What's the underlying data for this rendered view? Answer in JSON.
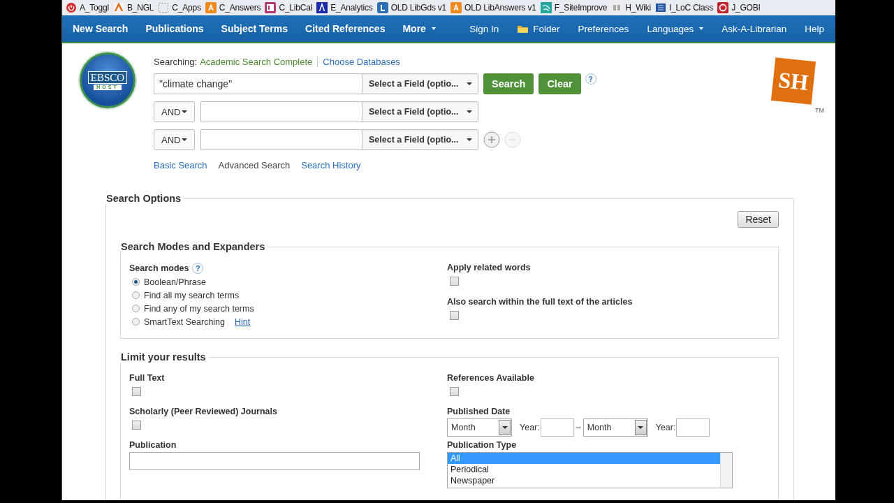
{
  "bookmarks": [
    {
      "label": "A_Toggl"
    },
    {
      "label": "B_NGL"
    },
    {
      "label": "C_Apps"
    },
    {
      "label": "C_Answers"
    },
    {
      "label": "C_LibCal"
    },
    {
      "label": "E_Analytics"
    },
    {
      "label": "OLD LibGds v1"
    },
    {
      "label": "OLD LibAnswers v1"
    },
    {
      "label": "F_SiteImprove"
    },
    {
      "label": "H_Wiki"
    },
    {
      "label": "I_LoC Class"
    },
    {
      "label": "J_GOBI"
    }
  ],
  "nav": {
    "left": [
      {
        "label": "New Search",
        "kind": "link",
        "dropdown": false
      },
      {
        "label": "Publications",
        "kind": "link",
        "dropdown": false
      },
      {
        "label": "Subject Terms",
        "kind": "link",
        "dropdown": false
      },
      {
        "label": "Cited References",
        "kind": "link",
        "dropdown": false
      },
      {
        "label": "More",
        "kind": "link",
        "dropdown": true
      }
    ],
    "right": [
      {
        "label": "Sign In",
        "kind": "link",
        "dropdown": false
      },
      {
        "label": "Folder",
        "kind": "folder",
        "dropdown": false
      },
      {
        "label": "Preferences",
        "kind": "link",
        "dropdown": false
      },
      {
        "label": "Languages",
        "kind": "link",
        "dropdown": true
      },
      {
        "label": "Ask-A-Librarian",
        "kind": "link",
        "dropdown": false
      },
      {
        "label": "Help",
        "kind": "link",
        "dropdown": false
      }
    ]
  },
  "logo": {
    "text": "EBSCO",
    "subtext": "HOST"
  },
  "search": {
    "searching_label": "Searching:",
    "database": "Academic Search Complete",
    "choose_link": "Choose Databases",
    "rows": [
      {
        "value": "\"climate change\"",
        "field": "Select a Field (optio..."
      },
      {
        "operator": "AND",
        "field": "Select a Field (optio..."
      },
      {
        "operator": "AND",
        "field": "Select a Field (optio..."
      }
    ],
    "buttons": [
      "Search",
      "Clear"
    ],
    "help": "?",
    "row_buttons": [
      {
        "kind": "add",
        "disabled": false
      },
      {
        "kind": "remove",
        "disabled": true
      }
    ],
    "modes": [
      {
        "label": "Basic Search",
        "selected": false
      },
      {
        "label": "Advanced Search",
        "selected": true
      },
      {
        "label": "Search History",
        "selected": false
      }
    ]
  },
  "brand": {
    "text": "SH",
    "mark": "TM"
  },
  "options": {
    "title": "Search Options",
    "reset": "Reset",
    "expanders": {
      "title": "Search Modes and Expanders",
      "modes_label": "Search modes",
      "help": "?",
      "modes": [
        {
          "label": "Boolean/Phrase",
          "selected": true
        },
        {
          "label": "Find all my search terms",
          "selected": false
        },
        {
          "label": "Find any of my search terms",
          "selected": false
        },
        {
          "label": "SmartText Searching",
          "selected": false,
          "hint": "Hint"
        }
      ],
      "checks": [
        {
          "label": "Apply related words",
          "checked": false
        },
        {
          "label": "Also search within the full text of the articles",
          "checked": false
        }
      ]
    },
    "limits": {
      "title": "Limit your results",
      "fields": [
        {
          "kind": "checkbox",
          "label": "Full Text",
          "checked": false
        },
        {
          "kind": "checkbox",
          "label": "References Available",
          "checked": false
        },
        {
          "kind": "checkbox",
          "label": "Scholarly (Peer Reviewed) Journals",
          "checked": false
        },
        {
          "kind": "date",
          "label": "Published Date",
          "from_month": "Month",
          "from_year_label": "Year:",
          "dash": "–",
          "to_month": "Month",
          "to_year_label": "Year:"
        },
        {
          "kind": "text",
          "label": "Publication"
        },
        {
          "kind": "listbox",
          "label": "Publication Type",
          "options": [
            {
              "label": "All",
              "selected": true
            },
            {
              "label": "Periodical",
              "selected": false
            },
            {
              "label": "Newspaper",
              "selected": false
            }
          ]
        }
      ]
    }
  }
}
